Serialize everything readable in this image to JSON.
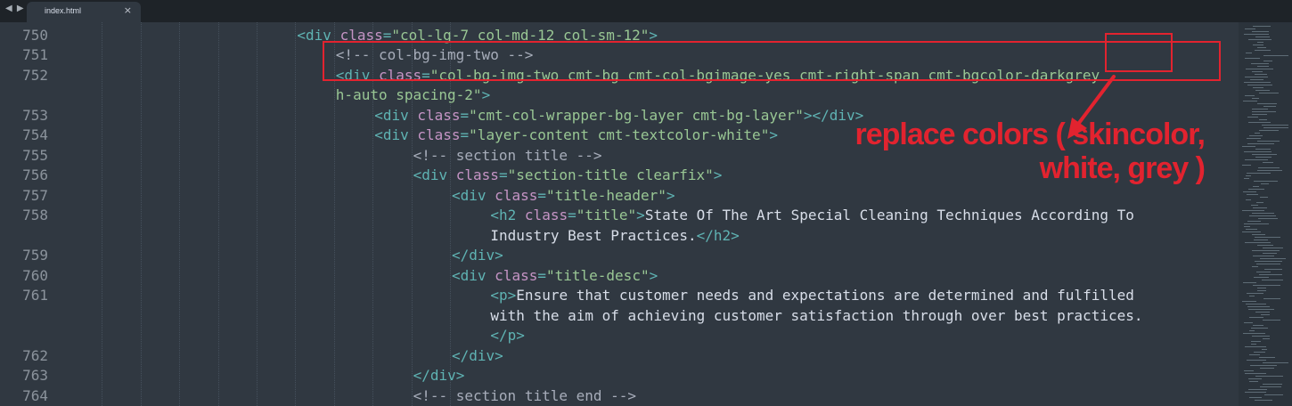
{
  "tab": {
    "filename": "index.html",
    "close_glyph": "×",
    "nav_glyph": "◀ ▶"
  },
  "editor": {
    "lines": [
      {
        "number": "750",
        "indent": 6,
        "parts": [
          [
            "tg",
            "<div "
          ],
          [
            "at",
            "class"
          ],
          [
            "tg",
            "="
          ],
          [
            "st",
            "\"col-lg-7 col-md-12 col-sm-12\""
          ],
          [
            "tg",
            ">"
          ]
        ]
      },
      {
        "number": "751",
        "indent": 7,
        "parts": [
          [
            "cm",
            "<!-- col-bg-img-two -->"
          ]
        ]
      },
      {
        "number": "752",
        "indent": 7,
        "parts": [
          [
            "tg",
            "<div "
          ],
          [
            "at",
            "class"
          ],
          [
            "tg",
            "="
          ],
          [
            "st",
            "\"col-bg-img-two cmt-bg cmt-col-bgimage-yes cmt-right-span cmt-bgcolor-darkgrey"
          ]
        ]
      },
      {
        "number": "",
        "indent": 7,
        "parts": [
          [
            "st",
            "h-auto spacing-2\""
          ],
          [
            "tg",
            ">"
          ]
        ]
      },
      {
        "number": "753",
        "indent": 8,
        "parts": [
          [
            "tg",
            "<div "
          ],
          [
            "at",
            "class"
          ],
          [
            "tg",
            "="
          ],
          [
            "st",
            "\"cmt-col-wrapper-bg-layer cmt-bg-layer\""
          ],
          [
            "tg",
            "></div>"
          ]
        ]
      },
      {
        "number": "754",
        "indent": 8,
        "parts": [
          [
            "tg",
            "<div "
          ],
          [
            "at",
            "class"
          ],
          [
            "tg",
            "="
          ],
          [
            "st",
            "\"layer-content cmt-textcolor-white\""
          ],
          [
            "tg",
            ">"
          ]
        ]
      },
      {
        "number": "755",
        "indent": 9,
        "parts": [
          [
            "cm",
            "<!-- section title -->"
          ]
        ]
      },
      {
        "number": "756",
        "indent": 9,
        "parts": [
          [
            "tg",
            "<div "
          ],
          [
            "at",
            "class"
          ],
          [
            "tg",
            "="
          ],
          [
            "st",
            "\"section-title clearfix\""
          ],
          [
            "tg",
            ">"
          ]
        ]
      },
      {
        "number": "757",
        "indent": 10,
        "parts": [
          [
            "tg",
            "<div "
          ],
          [
            "at",
            "class"
          ],
          [
            "tg",
            "="
          ],
          [
            "st",
            "\"title-header\""
          ],
          [
            "tg",
            ">"
          ]
        ]
      },
      {
        "number": "758",
        "indent": 11,
        "parts": [
          [
            "tg",
            "<h2 "
          ],
          [
            "at",
            "class"
          ],
          [
            "tg",
            "="
          ],
          [
            "st",
            "\"title\""
          ],
          [
            "tg",
            ">"
          ],
          [
            "tx",
            "State Of The Art Special Cleaning Techniques According To"
          ]
        ]
      },
      {
        "number": "",
        "indent": 11,
        "parts": [
          [
            "tx",
            "Industry Best Practices."
          ],
          [
            "tg",
            "</h2>"
          ]
        ]
      },
      {
        "number": "759",
        "indent": 10,
        "parts": [
          [
            "tg",
            "</div>"
          ]
        ]
      },
      {
        "number": "760",
        "indent": 10,
        "parts": [
          [
            "tg",
            "<div "
          ],
          [
            "at",
            "class"
          ],
          [
            "tg",
            "="
          ],
          [
            "st",
            "\"title-desc\""
          ],
          [
            "tg",
            ">"
          ]
        ]
      },
      {
        "number": "761",
        "indent": 11,
        "parts": [
          [
            "tg",
            "<p>"
          ],
          [
            "tx",
            "Ensure that customer needs and expectations are determined and fulfilled"
          ]
        ]
      },
      {
        "number": "",
        "indent": 11,
        "parts": [
          [
            "tx",
            "with the aim of achieving customer satisfaction through over best practices."
          ]
        ]
      },
      {
        "number": "",
        "indent": 11,
        "parts": [
          [
            "tg",
            "</p>"
          ]
        ]
      },
      {
        "number": "762",
        "indent": 10,
        "parts": [
          [
            "tg",
            "</div>"
          ]
        ]
      },
      {
        "number": "763",
        "indent": 9,
        "parts": [
          [
            "tg",
            "</div>"
          ]
        ]
      },
      {
        "number": "764",
        "indent": 9,
        "parts": [
          [
            "cm",
            "<!-- section title end -->"
          ]
        ]
      }
    ]
  },
  "annotation": {
    "text": "replace colors ( skincolor,\nwhite, grey )",
    "color": "#e2232f"
  },
  "colors": {
    "background": "#303841",
    "tag": "#5fb3b3",
    "attribute": "#c594c5",
    "string": "#99c794",
    "comment": "#a7adba",
    "text": "#d8dee9",
    "line_number": "#8b939c"
  }
}
